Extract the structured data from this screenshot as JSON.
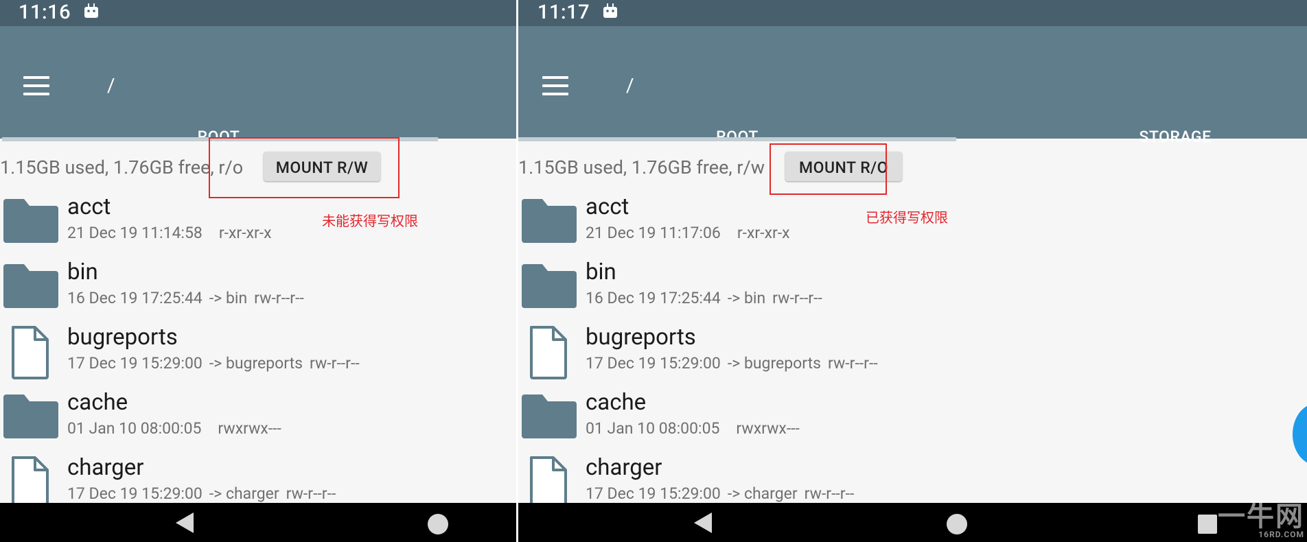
{
  "left": {
    "time": "11:16",
    "path": "/",
    "tabs": [
      "ROOT"
    ],
    "usage": "1.15GB used, 1.76GB free, r/o",
    "mount_button": "MOUNT R/W",
    "annotation": "未能获得写权限",
    "files": [
      {
        "name": "acct",
        "type": "folder",
        "date": "21 Dec 19 11:14:58",
        "link": "",
        "perms": "r-xr-xr-x"
      },
      {
        "name": "bin",
        "type": "folder",
        "date": "16 Dec 19 17:25:44",
        "link": "-> bin",
        "perms": "rw-r--r--"
      },
      {
        "name": "bugreports",
        "type": "file",
        "date": "17 Dec 19 15:29:00",
        "link": "-> bugreports",
        "perms": "rw-r--r--"
      },
      {
        "name": "cache",
        "type": "folder",
        "date": "01 Jan 10 08:00:05",
        "link": "",
        "perms": "rwxrwx---"
      },
      {
        "name": "charger",
        "type": "file",
        "date": "17 Dec 19 15:29:00",
        "link": "-> charger",
        "perms": "rw-r--r--"
      }
    ]
  },
  "right": {
    "time": "11:17",
    "path": "/",
    "tabs": [
      "ROOT",
      "STORAGE"
    ],
    "usage": "1.15GB used, 1.76GB free, r/w",
    "mount_button": "MOUNT R/O",
    "annotation": "已获得写权限",
    "files": [
      {
        "name": "acct",
        "type": "folder",
        "date": "21 Dec 19 11:17:06",
        "link": "",
        "perms": "r-xr-xr-x"
      },
      {
        "name": "bin",
        "type": "folder",
        "date": "16 Dec 19 17:25:44",
        "link": "-> bin",
        "perms": "rw-r--r--"
      },
      {
        "name": "bugreports",
        "type": "file",
        "date": "17 Dec 19 15:29:00",
        "link": "-> bugreports",
        "perms": "rw-r--r--"
      },
      {
        "name": "cache",
        "type": "folder",
        "date": "01 Jan 10 08:00:05",
        "link": "",
        "perms": "rwxrwx---"
      },
      {
        "name": "charger",
        "type": "file",
        "date": "17 Dec 19 15:29:00",
        "link": "-> charger",
        "perms": "rw-r--r--"
      }
    ]
  },
  "icons": {
    "status": "android-debug-icon",
    "menu": "hamburger-menu-icon",
    "folder": "folder-icon",
    "file": "file-icon",
    "nav_back": "back-icon",
    "nav_home": "home-icon",
    "nav_recent": "recent-apps-icon"
  },
  "colors": {
    "status_bar": "#48606e",
    "toolbar": "#607d8b",
    "folder": "#5f7d8b",
    "annotation": "#e3252d",
    "fab": "#1e9bea"
  },
  "watermark": {
    "main": "一牛网",
    "sub": "16RD.COM"
  }
}
